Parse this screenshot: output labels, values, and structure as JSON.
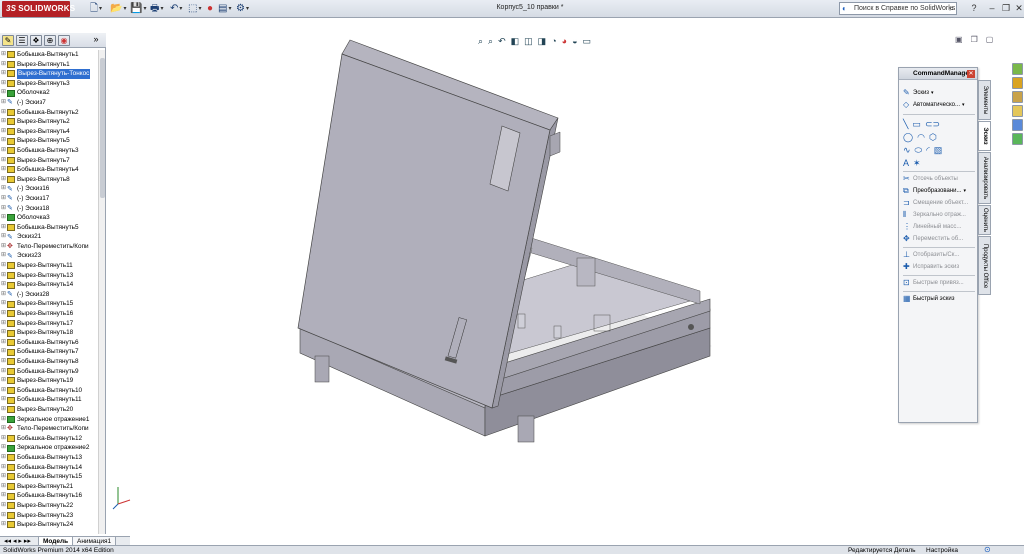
{
  "app": {
    "logo_text": "SOLIDWORKS",
    "logo_prefix": "3S",
    "document_title": "Корпус5_10 правки *",
    "help_search_placeholder": "Поиск в Справке по SolidWorks",
    "brand_color": "#b32025"
  },
  "toolbar": {
    "icons": [
      "new-document-icon",
      "open-icon",
      "save-icon",
      "print-icon",
      "undo-icon",
      "select-icon",
      "rebuild-icon",
      "file-properties-icon",
      "options-icon"
    ]
  },
  "window_controls": [
    "help-icon",
    "minimize-icon",
    "restore-icon",
    "close-icon"
  ],
  "feature_tree": {
    "tabs": [
      "feature-manager-tab",
      "property-manager-tab",
      "configuration-manager-tab",
      "dimxpert-tab",
      "display-manager-tab"
    ],
    "items": [
      {
        "label": "Бобышка-Вытянуть1",
        "kind": "feature"
      },
      {
        "label": "Вырез-Вытянуть1",
        "kind": "feature"
      },
      {
        "label": "Вырез-Вытянуть-Тонкос",
        "kind": "feature",
        "selected": true
      },
      {
        "label": "Вырез-Вытянуть3",
        "kind": "feature"
      },
      {
        "label": "Оболочка2",
        "kind": "shell"
      },
      {
        "label": "(-) Эскиз7",
        "kind": "sketch"
      },
      {
        "label": "Бобышка-Вытянуть2",
        "kind": "feature"
      },
      {
        "label": "Вырез-Вытянуть2",
        "kind": "feature"
      },
      {
        "label": "Вырез-Вытянуть4",
        "kind": "feature"
      },
      {
        "label": "Вырез-Вытянуть5",
        "kind": "feature"
      },
      {
        "label": "Бобышка-Вытянуть3",
        "kind": "feature"
      },
      {
        "label": "Вырез-Вытянуть7",
        "kind": "feature"
      },
      {
        "label": "Бобышка-Вытянуть4",
        "kind": "feature"
      },
      {
        "label": "Вырез-Вытянуть8",
        "kind": "feature"
      },
      {
        "label": "(-) Эскиз16",
        "kind": "sketch"
      },
      {
        "label": "(-) Эскиз17",
        "kind": "sketch"
      },
      {
        "label": "(-) Эскиз18",
        "kind": "sketch"
      },
      {
        "label": "Оболочка3",
        "kind": "shell"
      },
      {
        "label": "Бобышка-Вытянуть5",
        "kind": "feature"
      },
      {
        "label": "Эскиз21",
        "kind": "sketch"
      },
      {
        "label": "Тело-Переместить/Копи",
        "kind": "move"
      },
      {
        "label": "Эскиз23",
        "kind": "sketch"
      },
      {
        "label": "Вырез-Вытянуть11",
        "kind": "feature"
      },
      {
        "label": "Вырез-Вытянуть13",
        "kind": "feature"
      },
      {
        "label": "Вырез-Вытянуть14",
        "kind": "feature"
      },
      {
        "label": "(-) Эскиз28",
        "kind": "sketch"
      },
      {
        "label": "Вырез-Вытянуть15",
        "kind": "feature"
      },
      {
        "label": "Вырез-Вытянуть16",
        "kind": "feature"
      },
      {
        "label": "Вырез-Вытянуть17",
        "kind": "feature"
      },
      {
        "label": "Вырез-Вытянуть18",
        "kind": "feature"
      },
      {
        "label": "Бобышка-Вытянуть6",
        "kind": "feature"
      },
      {
        "label": "Бобышка-Вытянуть7",
        "kind": "feature"
      },
      {
        "label": "Бобышка-Вытянуть8",
        "kind": "feature"
      },
      {
        "label": "Бобышка-Вытянуть9",
        "kind": "feature"
      },
      {
        "label": "Вырез-Вытянуть19",
        "kind": "feature"
      },
      {
        "label": "Бобышка-Вытянуть10",
        "kind": "feature"
      },
      {
        "label": "Бобышка-Вытянуть11",
        "kind": "feature"
      },
      {
        "label": "Вырез-Вытянуть20",
        "kind": "feature"
      },
      {
        "label": "Зеркальное отражение1",
        "kind": "shell"
      },
      {
        "label": "Тело-Переместить/Копи",
        "kind": "move"
      },
      {
        "label": "Бобышка-Вытянуть12",
        "kind": "feature"
      },
      {
        "label": "Зеркальное отражение2",
        "kind": "shell"
      },
      {
        "label": "Бобышка-Вытянуть13",
        "kind": "feature"
      },
      {
        "label": "Бобышка-Вытянуть14",
        "kind": "feature"
      },
      {
        "label": "Бобышка-Вытянуть15",
        "kind": "feature"
      },
      {
        "label": "Вырез-Вытянуть21",
        "kind": "feature"
      },
      {
        "label": "Бобышка-Вытянуть16",
        "kind": "feature"
      },
      {
        "label": "Вырез-Вытянуть22",
        "kind": "feature"
      },
      {
        "label": "Вырез-Вытянуть23",
        "kind": "feature"
      },
      {
        "label": "Вырез-Вытянуть24",
        "kind": "feature"
      }
    ]
  },
  "bottom_tabs": {
    "model": "Модель",
    "animation": "Анимация1"
  },
  "status_bar": {
    "edition": "SolidWorks Premium 2014 x64 Edition",
    "editing": "Редактируется Деталь",
    "custom": "Настройка"
  },
  "command_manager": {
    "title": "CommandManager",
    "sketch": "Эскиз",
    "auto_dimension": "Автоматическо...",
    "trim": "Отсечь объекты",
    "convert": "Преобразовани...",
    "offset": "Смещение объект...",
    "mirror": "Зеркально отраж...",
    "linear_pattern": "Линейный масс...",
    "move": "Переместить об...",
    "display": "Отобразить/Ск...",
    "repair": "Исправить эскиз",
    "rapid_snaps": "Быстрые привяз...",
    "rapid_sketch": "Быстрый эскиз",
    "vtabs": [
      "Элементы",
      "Эскиз",
      "Анализировать",
      "Оценить",
      "Продукты Office"
    ]
  }
}
